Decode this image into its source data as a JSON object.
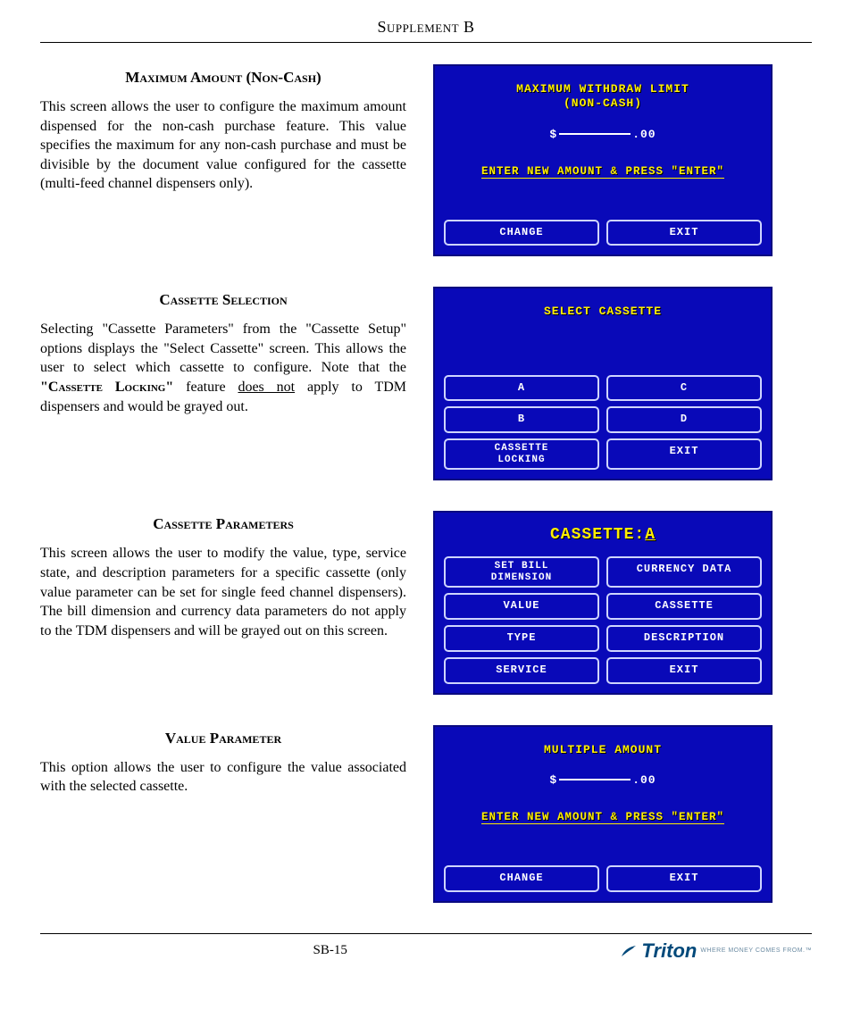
{
  "header": "Supplement B",
  "page_number": "SB-15",
  "sections": [
    {
      "title": "Maximum Amount (Non-Cash)",
      "body": "This screen allows the user to configure the maximum amount dispensed for the non-cash purchase feature.  This value specifies the maximum for any non-cash purchase and must be divisible by the document value configured for the cassette (multi-feed channel dispensers only)."
    },
    {
      "title": "Cassette Selection",
      "body_pre": "Selecting \"Cassette Parameters\" from the \"Cassette Setup\" options displays the \"Select Cassette\" screen. This allows the user to select which cassette to configure.  Note that the ",
      "body_bold": "\"Cassette Locking\"",
      "body_mid": " feature ",
      "body_under": "does not",
      "body_post": " apply to TDM dispensers and would be grayed out."
    },
    {
      "title": "Cassette Parameters",
      "body": "This screen allows the user to modify the value, type, service state, and description parameters for a specific cassette (only value parameter can be set for single feed channel dispensers).  The bill dimension and currency data parameters do not apply to the TDM dispensers and will be grayed out on this screen."
    },
    {
      "title": "Value Parameter",
      "body": "This option allows the user to configure the value associated with the selected cassette."
    }
  ],
  "screens": {
    "max_withdraw": {
      "title1": "MAXIMUM WITHDRAW LIMIT",
      "title2": "(NON-CASH)",
      "amount_prefix": "$",
      "amount_suffix": ".00",
      "prompt": "ENTER NEW AMOUNT & PRESS \"ENTER\"",
      "btn1": "CHANGE",
      "btn2": "EXIT"
    },
    "select_cassette": {
      "title": "SELECT CASSETTE",
      "a": "A",
      "b": "B",
      "c": "C",
      "d": "D",
      "locking1": "CASSETTE",
      "locking2": "LOCKING",
      "exit": "EXIT"
    },
    "cassette_params": {
      "title_prefix": "CASSETTE:",
      "title_letter": "A",
      "set_bill1": "SET BILL",
      "set_bill2": "DIMENSION",
      "currency": "CURRENCY DATA",
      "value": "VALUE",
      "cassette": "CASSETTE",
      "type": "TYPE",
      "description": "DESCRIPTION",
      "service": "SERVICE",
      "exit": "EXIT"
    },
    "multiple_amount": {
      "title": "MULTIPLE AMOUNT",
      "amount_prefix": "$",
      "amount_suffix": ".00",
      "prompt": "ENTER NEW AMOUNT & PRESS \"ENTER\"",
      "btn1": "CHANGE",
      "btn2": "EXIT"
    }
  },
  "logo": {
    "name": "Triton",
    "tag": "WHERE MONEY COMES FROM.™"
  }
}
